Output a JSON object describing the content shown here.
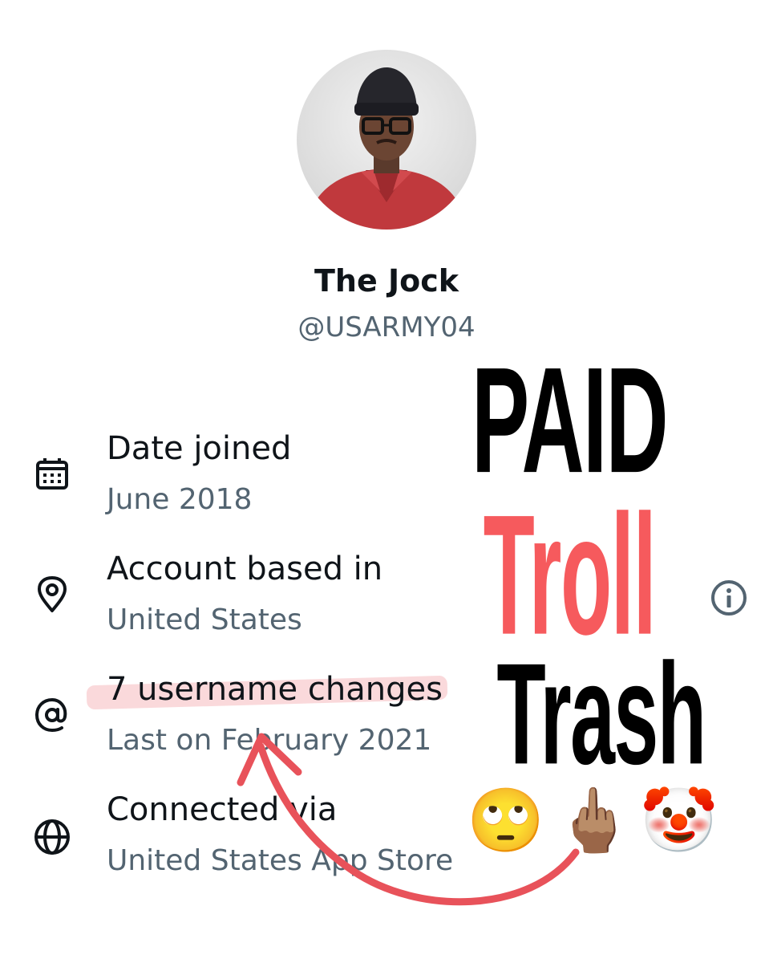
{
  "profile": {
    "name": "The Jock",
    "handle": "@USARMY04"
  },
  "details": [
    {
      "icon": "calendar-icon",
      "title": "Date joined",
      "value": "June 2018"
    },
    {
      "icon": "location-pin-icon",
      "title": "Account based in",
      "value": "United States"
    },
    {
      "icon": "at-sign-icon",
      "title": "7 username changes",
      "value": "Last on February 2021"
    },
    {
      "icon": "globe-icon",
      "title": "Connected via",
      "value": "United States App Store"
    }
  ],
  "overlay": {
    "line1": "PAID",
    "line2": "Troll",
    "line3": "Trash",
    "emojis": [
      "🙄",
      "🖕🏽",
      "🤡"
    ]
  },
  "colors": {
    "text_primary": "#0f1419",
    "text_secondary": "#536471",
    "troll_red": "#f65a5d",
    "arrow_red": "#e8525a",
    "highlight_pink": "#f5aaaf"
  }
}
